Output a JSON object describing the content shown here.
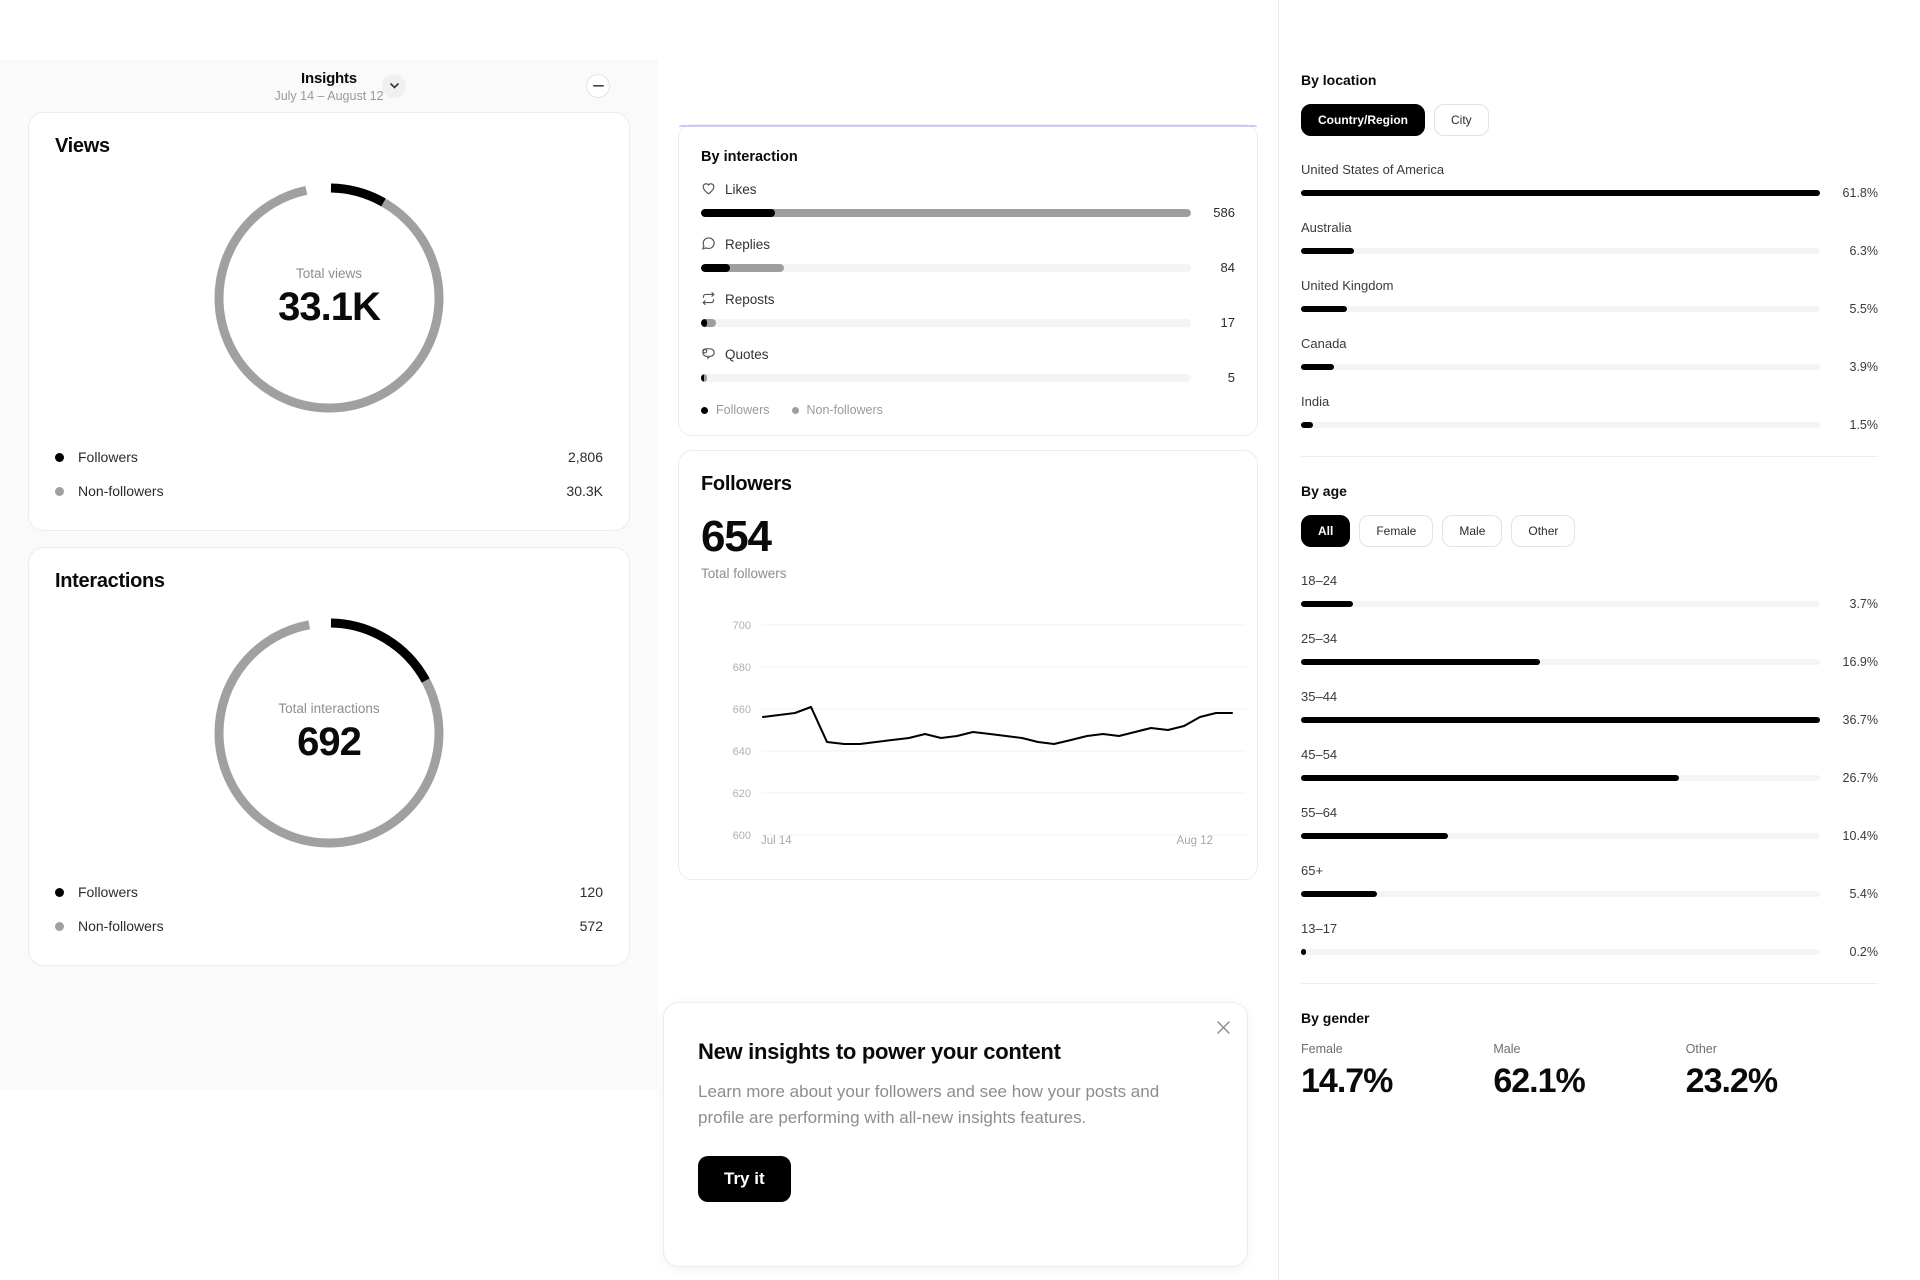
{
  "header": {
    "title": "Insights",
    "date_range": "July 14 – August 12",
    "chevron_icon": "chevron-down-icon",
    "minimize_icon": "minimize-icon"
  },
  "views_card": {
    "title": "Views",
    "center_label": "Total views",
    "center_value": "33.1K",
    "legend": [
      {
        "label": "Followers",
        "value": "2,806",
        "color": "#000000"
      },
      {
        "label": "Non-followers",
        "value": "30.3K",
        "color": "#a0a0a0"
      }
    ]
  },
  "interactions_card": {
    "title": "Interactions",
    "center_label": "Total interactions",
    "center_value": "692",
    "legend": [
      {
        "label": "Followers",
        "value": "120",
        "color": "#000000"
      },
      {
        "label": "Non-followers",
        "value": "572",
        "color": "#a0a0a0"
      }
    ]
  },
  "by_interaction": {
    "title": "By interaction",
    "rows": [
      {
        "label": "Likes",
        "icon": "heart-icon",
        "value": "586",
        "followers_pct": 15,
        "total_pct": 100
      },
      {
        "label": "Replies",
        "icon": "reply-icon",
        "value": "84",
        "followers_pct": 6,
        "total_pct": 17
      },
      {
        "label": "Reposts",
        "icon": "repost-icon",
        "value": "17",
        "followers_pct": 1,
        "total_pct": 3
      },
      {
        "label": "Quotes",
        "icon": "quote-icon",
        "value": "5",
        "followers_pct": 0.5,
        "total_pct": 1
      }
    ],
    "legend": [
      {
        "label": "Followers",
        "color": "#000000"
      },
      {
        "label": "Non-followers",
        "color": "#9e9e9e"
      }
    ]
  },
  "followers_card": {
    "title": "Followers",
    "total": "654",
    "total_sub": "Total followers",
    "x_start": "Jul 14",
    "x_end": "Aug 12"
  },
  "toast": {
    "title": "New insights to power your content",
    "body": "Learn more about your followers and see how your posts and profile are performing with all-new insights features.",
    "button": "Try it",
    "close_icon": "close-icon"
  },
  "by_location": {
    "title": "By location",
    "tabs": [
      {
        "label": "Country/Region",
        "active": true
      },
      {
        "label": "City",
        "active": false
      }
    ],
    "rows": [
      {
        "label": "United States of America",
        "value": "61.8%",
        "pct": 100
      },
      {
        "label": "Australia",
        "value": "6.3%",
        "pct": 10.2
      },
      {
        "label": "United Kingdom",
        "value": "5.5%",
        "pct": 8.9
      },
      {
        "label": "Canada",
        "value": "3.9%",
        "pct": 6.3
      },
      {
        "label": "India",
        "value": "1.5%",
        "pct": 2.4
      }
    ]
  },
  "by_age": {
    "title": "By age",
    "tabs": [
      {
        "label": "All",
        "active": true
      },
      {
        "label": "Female",
        "active": false
      },
      {
        "label": "Male",
        "active": false
      },
      {
        "label": "Other",
        "active": false
      }
    ],
    "rows": [
      {
        "label": "18–24",
        "value": "3.7%",
        "pct": 10.1
      },
      {
        "label": "25–34",
        "value": "16.9%",
        "pct": 46.0
      },
      {
        "label": "35–44",
        "value": "36.7%",
        "pct": 100
      },
      {
        "label": "45–54",
        "value": "26.7%",
        "pct": 72.8
      },
      {
        "label": "55–64",
        "value": "10.4%",
        "pct": 28.3
      },
      {
        "label": "65+",
        "value": "5.4%",
        "pct": 14.7
      },
      {
        "label": "13–17",
        "value": "0.2%",
        "pct": 0.6
      }
    ]
  },
  "by_gender": {
    "title": "By gender",
    "cells": [
      {
        "label": "Female",
        "value": "14.7%"
      },
      {
        "label": "Male",
        "value": "62.1%"
      },
      {
        "label": "Other",
        "value": "23.2%"
      }
    ]
  },
  "chart_data": [
    {
      "type": "pie",
      "title": "Views",
      "labels": [
        "Followers",
        "Non-followers"
      ],
      "values": [
        2806,
        30300
      ],
      "display_values": [
        "2,806",
        "30.3K"
      ],
      "total": 33100,
      "total_display": "33.1K",
      "center_label": "Total views",
      "colors": [
        "#000000",
        "#a0a0a0"
      ]
    },
    {
      "type": "pie",
      "title": "Interactions",
      "labels": [
        "Followers",
        "Non-followers"
      ],
      "values": [
        120,
        572
      ],
      "display_values": [
        "120",
        "572"
      ],
      "total": 692,
      "total_display": "692",
      "center_label": "Total interactions",
      "colors": [
        "#000000",
        "#a0a0a0"
      ]
    },
    {
      "type": "bar",
      "title": "By interaction",
      "orientation": "horizontal",
      "categories": [
        "Likes",
        "Replies",
        "Reposts",
        "Quotes"
      ],
      "values": [
        586,
        84,
        17,
        5
      ],
      "series": [
        {
          "name": "Followers",
          "values": [
            88,
            30,
            5,
            1
          ],
          "color": "#000000"
        },
        {
          "name": "Non-followers",
          "values": [
            498,
            54,
            12,
            4
          ],
          "color": "#9e9e9e"
        }
      ],
      "legend": [
        "Followers",
        "Non-followers"
      ],
      "legend_position": "bottom"
    },
    {
      "type": "line",
      "title": "Followers",
      "ylabel": "",
      "xlabel": "",
      "ylim": [
        580,
        700
      ],
      "yticks": [
        600,
        620,
        640,
        660,
        680,
        700
      ],
      "x": [
        "Jul 14",
        "Jul 15",
        "Jul 16",
        "Jul 17",
        "Jul 18",
        "Jul 19",
        "Jul 20",
        "Jul 21",
        "Jul 22",
        "Jul 23",
        "Jul 24",
        "Jul 25",
        "Jul 26",
        "Jul 27",
        "Jul 28",
        "Jul 29",
        "Jul 30",
        "Jul 31",
        "Aug 1",
        "Aug 2",
        "Aug 3",
        "Aug 4",
        "Aug 5",
        "Aug 6",
        "Aug 7",
        "Aug 8",
        "Aug 9",
        "Aug 10",
        "Aug 11",
        "Aug 12"
      ],
      "xtick_labels": [
        "Jul 14",
        "Aug 12"
      ],
      "values": [
        656,
        657,
        658,
        661,
        644,
        643,
        643,
        644,
        645,
        646,
        648,
        646,
        647,
        649,
        648,
        647,
        646,
        644,
        643,
        645,
        647,
        648,
        647,
        649,
        651,
        650,
        652,
        656,
        658,
        658
      ],
      "grid": true,
      "line_color": "#000000"
    },
    {
      "type": "bar",
      "title": "By location",
      "orientation": "horizontal",
      "categories": [
        "United States of America",
        "Australia",
        "United Kingdom",
        "Canada",
        "India"
      ],
      "values": [
        61.8,
        6.3,
        5.5,
        3.9,
        1.5
      ],
      "unit": "%",
      "bar_color": "#000000"
    },
    {
      "type": "bar",
      "title": "By age",
      "orientation": "horizontal",
      "categories": [
        "18–24",
        "25–34",
        "35–44",
        "45–54",
        "55–64",
        "65+",
        "13–17"
      ],
      "values": [
        3.7,
        16.9,
        36.7,
        26.7,
        10.4,
        5.4,
        0.2
      ],
      "unit": "%",
      "bar_color": "#000000"
    },
    {
      "type": "bar",
      "title": "By gender",
      "categories": [
        "Female",
        "Male",
        "Other"
      ],
      "values": [
        14.7,
        62.1,
        23.2
      ],
      "unit": "%"
    }
  ]
}
